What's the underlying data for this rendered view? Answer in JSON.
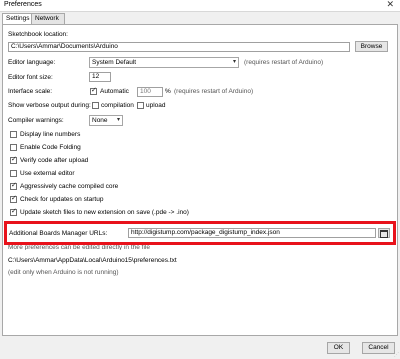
{
  "window": {
    "title": "Preferences",
    "close_glyph": "✕"
  },
  "tabs": [
    {
      "label": "Settings"
    },
    {
      "label": "Network"
    }
  ],
  "sketchbook": {
    "label": "Sketchbook location:",
    "value": "C:\\Users\\Ammar\\Documents\\Arduino",
    "browse_label": "Browse"
  },
  "language": {
    "label": "Editor language:",
    "value": "System Default",
    "note": "(requires restart of Arduino)"
  },
  "font_size": {
    "label": "Editor font size:",
    "value": "12"
  },
  "interface_scale": {
    "label": "Interface scale:",
    "automatic_label": "Automatic",
    "automatic_checked": true,
    "value": "100",
    "unit": "%",
    "note": "(requires restart of Arduino)"
  },
  "verbose": {
    "label": "Show verbose output during:",
    "compilation_label": "compilation",
    "upload_label": "upload"
  },
  "compiler_warnings": {
    "label": "Compiler warnings:",
    "value": "None"
  },
  "options": [
    {
      "label": "Display line numbers",
      "checked": false
    },
    {
      "label": "Enable Code Folding",
      "checked": false
    },
    {
      "label": "Verify code after upload",
      "checked": true
    },
    {
      "label": "Use external editor",
      "checked": false
    },
    {
      "label": "Aggressively cache compiled core",
      "checked": true
    },
    {
      "label": "Check for updates on startup",
      "checked": true
    },
    {
      "label": "Update sketch files to new extension on save (.pde -> .ino)",
      "checked": true
    }
  ],
  "boards_manager": {
    "label": "Additional Boards Manager URLs:",
    "value": "http://digistump.com/package_digistump_index.json"
  },
  "footer": {
    "more_prefs": "More preferences can be edited directly in the file",
    "prefs_path": "C:\\Users\\Ammar\\AppData\\Local\\Arduino15\\preferences.txt",
    "edit_note": "(edit only when Arduino is not running)"
  },
  "buttons": {
    "ok": "OK",
    "cancel": "Cancel"
  },
  "colors": {
    "highlight_box": "#e8121b",
    "panel_bg": "#ffffff",
    "window_bg": "#f0f0f0"
  }
}
